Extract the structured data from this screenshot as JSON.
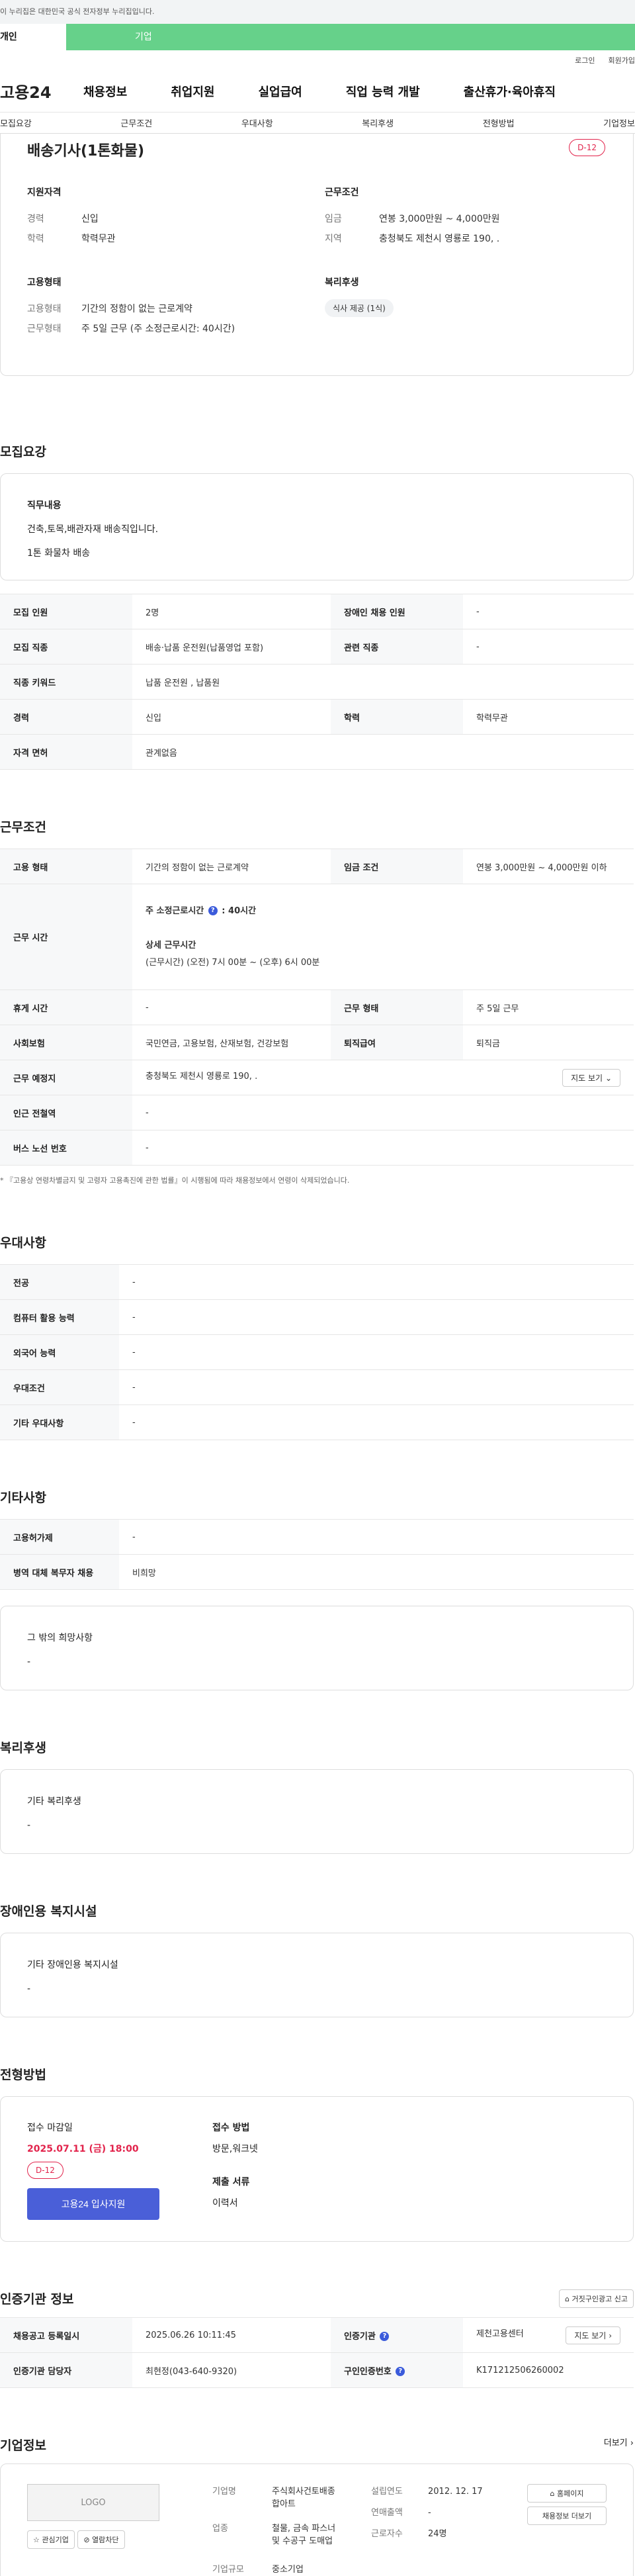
{
  "banner": {
    "text": "이 누리집은 대한민국 공식 전자정부 누리집입니다."
  },
  "user_tabs": [
    "개인",
    "기업"
  ],
  "util": {
    "login": "로그인",
    "join": "회원가입"
  },
  "gnb": {
    "logo": "고용24",
    "items": [
      "채용정보",
      "취업지원",
      "실업급여",
      "직업 능력 개발",
      "출산휴가·육아휴직"
    ]
  },
  "subnav": [
    "모집요강",
    "근무조건",
    "우대사항",
    "복리후생",
    "전형방법",
    "기업정보"
  ],
  "job": {
    "title": "배송기사(1톤화물)",
    "dday": "D-12",
    "qual": {
      "title": "지원자격",
      "rows": [
        {
          "k": "경력",
          "v": "신입"
        },
        {
          "k": "학력",
          "v": "학력무관"
        }
      ]
    },
    "cond": {
      "title": "근무조건",
      "rows": [
        {
          "k": "임금",
          "v": "연봉 3,000만원 ~ 4,000만원"
        },
        {
          "k": "지역",
          "v": "충청북도 제천시 영룡로 190, ."
        }
      ]
    },
    "emp": {
      "title": "고용형태",
      "rows": [
        {
          "k": "고용형태",
          "v": "기간의 정함이 없는 근로계약"
        },
        {
          "k": "근무형태",
          "v": "주 5일 근무 (주 소정근로시간: 40시간)"
        }
      ]
    },
    "welfare": {
      "title": "복리후생",
      "chip": "식사 제공 (1식)"
    }
  },
  "recruit": {
    "title": "모집요강",
    "duty_label": "직무내용",
    "duty_lines": [
      "건축,토목,배관자재 배송직입니다.",
      "1톤 화물차 배송"
    ],
    "headcount": {
      "k": "모집 인원",
      "v": "2명"
    },
    "disabled": {
      "k": "장애인 채용 인원",
      "v": "-"
    },
    "job_type": {
      "k": "모집 직종",
      "v": "배송·납품 운전원(납품영업 포함)"
    },
    "related": {
      "k": "관련 직종",
      "v": "-"
    },
    "keyword": {
      "k": "직종 키워드",
      "v": "납품 운전원 , 납품원"
    },
    "career": {
      "k": "경력",
      "v": "신입"
    },
    "edu": {
      "k": "학력",
      "v": "학력무관"
    },
    "license": {
      "k": "자격 면허",
      "v": "관계없음"
    }
  },
  "work": {
    "title": "근무조건",
    "emp_type": {
      "k": "고용 형태",
      "v": "기간의 정함이 없는 근로계약"
    },
    "wage": {
      "k": "임금 조건",
      "v": "연봉 3,000만원 ~ 4,000만원 이하"
    },
    "hours_label": "근무 시간",
    "weekly_label": "주 소정근로시간",
    "weekly_value": "40시간",
    "detail_label": "상세 근무시간",
    "detail_value": "(근무시간) (오전) 7시 00분 ~ (오후) 6시 00분",
    "rest": {
      "k": "휴게 시간",
      "v": "-"
    },
    "shift": {
      "k": "근무 형태",
      "v": "주 5일 근무"
    },
    "insurance": {
      "k": "사회보험",
      "v": "국민연금, 고용보험, 산재보험, 건강보험"
    },
    "severance": {
      "k": "퇴직급여",
      "v": "퇴직금"
    },
    "place": {
      "k": "근무 예정지",
      "v": "충청북도 제천시 영룡로 190, ."
    },
    "map_btn": "지도 보기",
    "subway": {
      "k": "인근 전철역",
      "v": "-"
    },
    "bus": {
      "k": "버스 노선 번호",
      "v": "-"
    },
    "note": "* 『고용상 연령차별금지 및 고령자 고용촉진에 관한 법률』이 시행됨에 따라 채용정보에서 연령이 삭제되었습니다."
  },
  "pref": {
    "title": "우대사항",
    "rows": [
      {
        "k": "전공",
        "v": "-"
      },
      {
        "k": "컴퓨터 활용 능력",
        "v": "-"
      },
      {
        "k": "외국어 능력",
        "v": "-"
      },
      {
        "k": "우대조건",
        "v": "-"
      },
      {
        "k": "기타 우대사항",
        "v": "-"
      }
    ]
  },
  "etc": {
    "title": "기타사항",
    "rows": [
      {
        "k": "고용허가제",
        "v": "-"
      },
      {
        "k": "병역 대체 복무자 채용",
        "v": "비희망"
      }
    ],
    "box_label": "그 밖의 희망사항",
    "box_value": "-"
  },
  "benefit": {
    "title": "복리후생",
    "label": "기타 복리후생",
    "value": "-"
  },
  "disfac": {
    "title": "장애인용 복지시설",
    "label": "기타 장애인용 복지시설",
    "value": "-"
  },
  "process": {
    "title": "전형방법",
    "deadline_label": "접수 마감일",
    "deadline": "2025.07.11 (금) 18:00",
    "dday": "D-12",
    "apply_btn": "고용24 입사지원",
    "method_label": "접수 방법",
    "method": "방문,워크넷",
    "docs_label": "제출 서류",
    "docs": "이력서"
  },
  "cert": {
    "title": "인증기관 정보",
    "report_btn": "거짓구인광고 신고",
    "reg_date": {
      "k": "채용공고 등록일시",
      "v": "2025.06.26 10:11:45"
    },
    "agency": {
      "k": "인증기관",
      "v": "제천고용센터"
    },
    "map_btn": "지도 보기",
    "manager": {
      "k": "인증기관 담당자",
      "v": "최현정(043-640-9320)"
    },
    "auth_no": {
      "k": "구인인증번호",
      "v": "K171212506260002"
    }
  },
  "company": {
    "title": "기업정보",
    "more": "더보기",
    "logo": "LOGO",
    "fav_btn": "관심기업",
    "block_btn": "열람차단",
    "name": {
      "k": "기업명",
      "v1": "주식회사건토배종",
      "v2": "합아트"
    },
    "industry": {
      "k": "업종",
      "v1": "철물, 금속 파스너",
      "v2": "및 수공구 도매업"
    },
    "size": {
      "k": "기업규모",
      "v": "중소기업"
    },
    "founded": {
      "k": "설립연도",
      "v": "2012. 12. 17"
    },
    "sales": {
      "k": "연매출액",
      "v": "-"
    },
    "employees": {
      "k": "근로자수",
      "v": "24명"
    },
    "home_btn": "홈페이지",
    "jobs_btn": "채용정보 더보기"
  }
}
